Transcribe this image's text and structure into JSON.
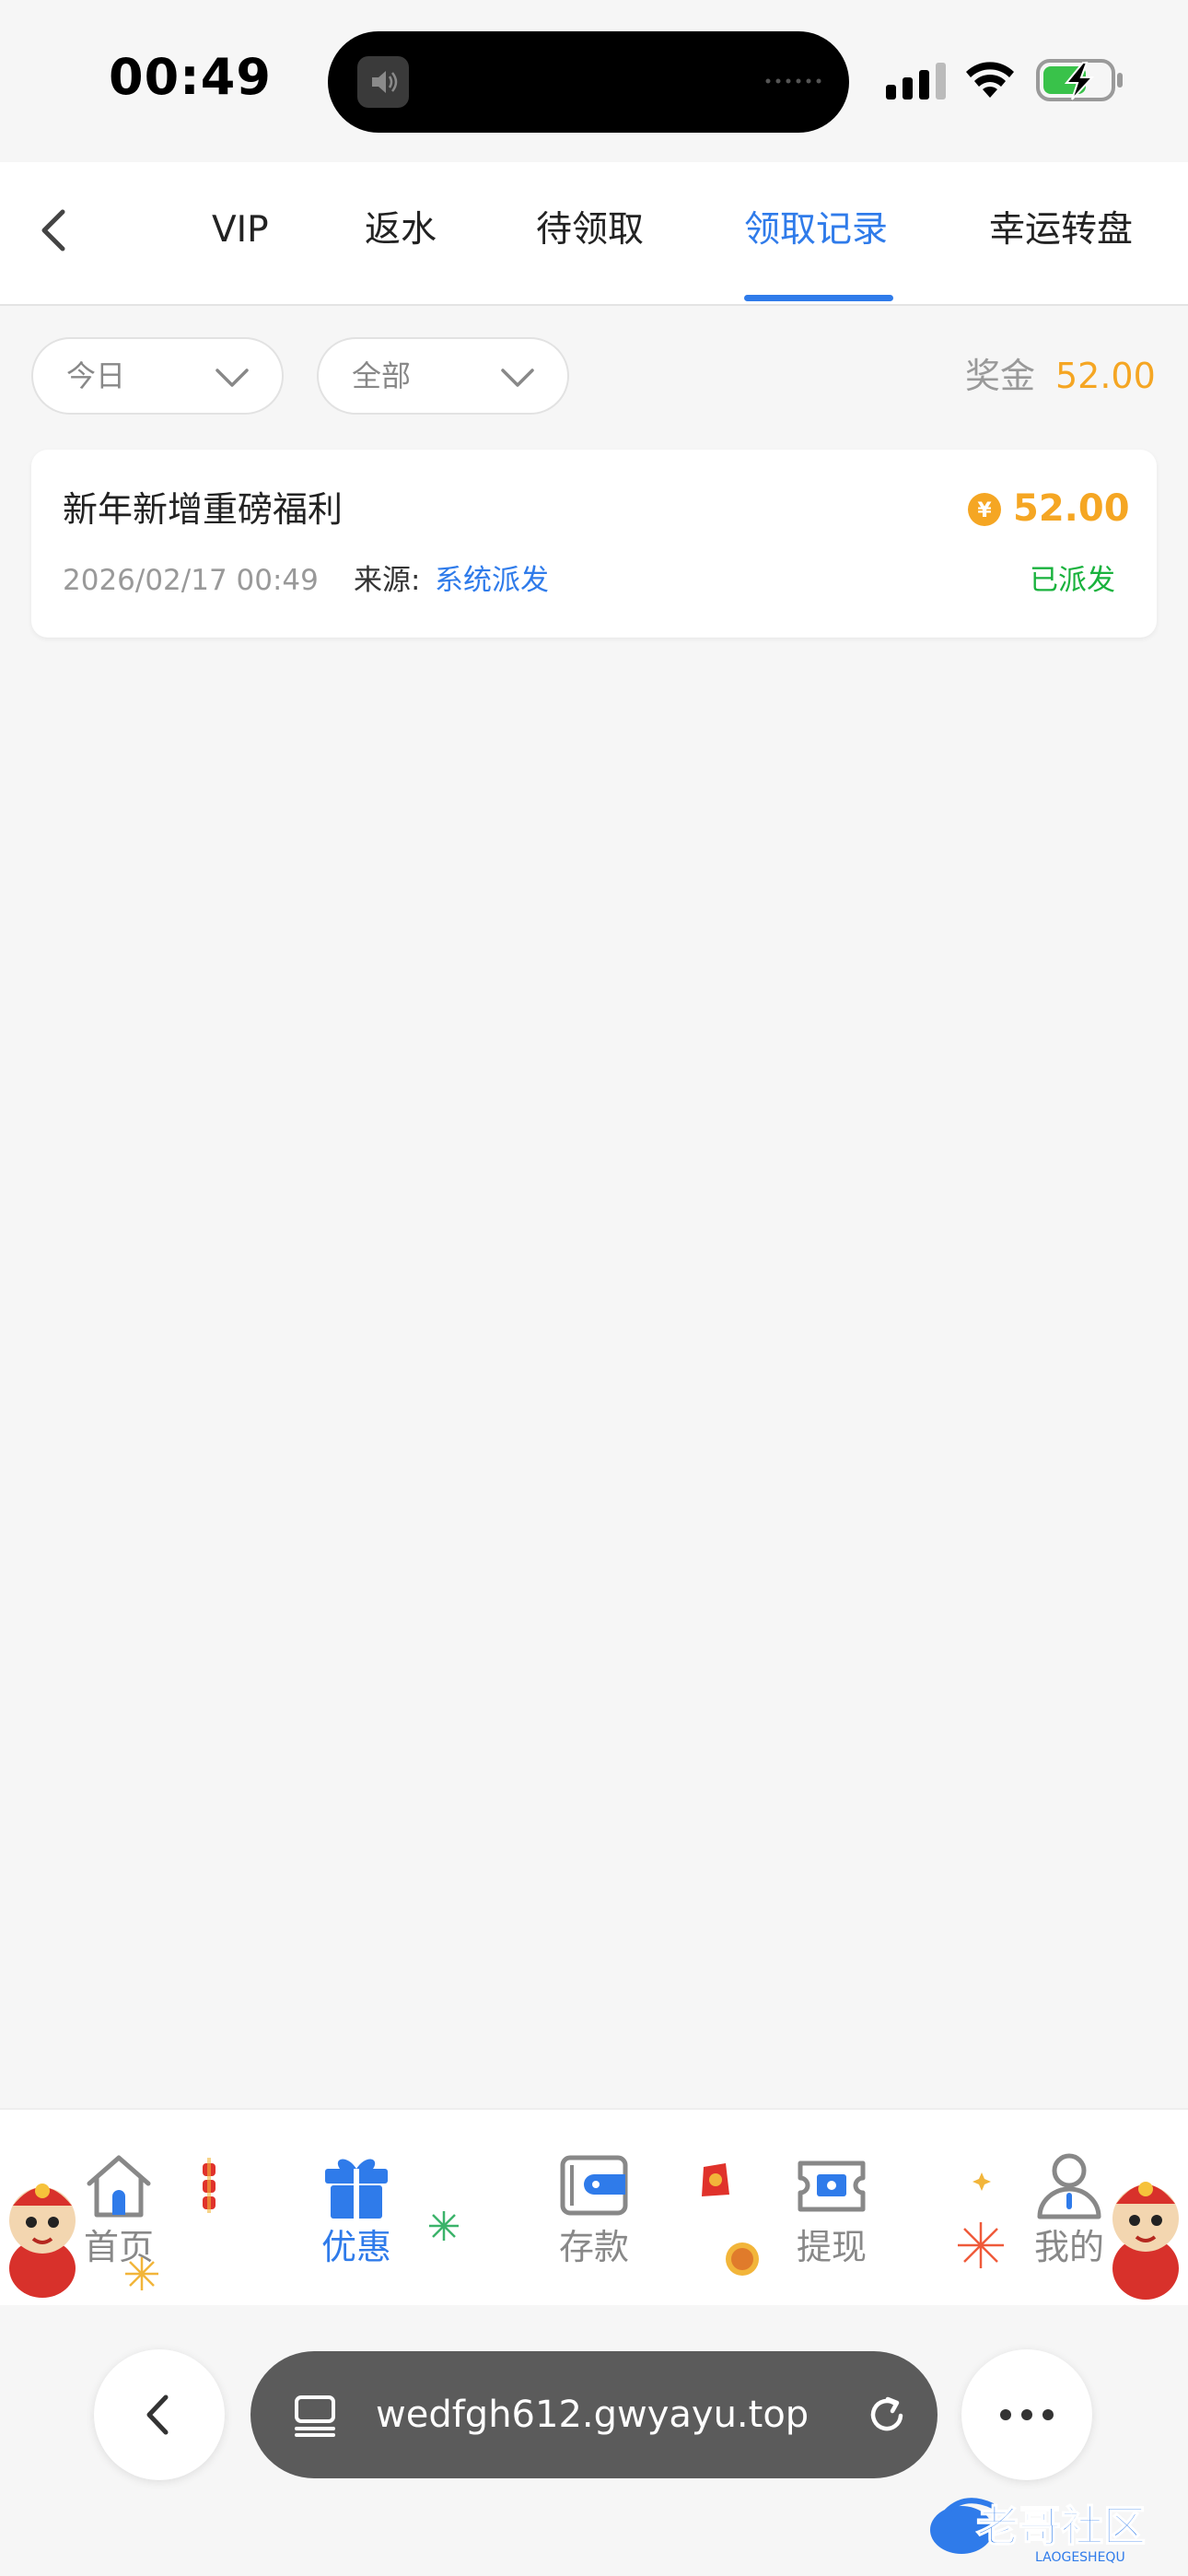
{
  "status_bar": {
    "time": "00:49"
  },
  "header": {
    "tabs": [
      {
        "label": "VIP",
        "active": false
      },
      {
        "label": "返水",
        "active": false
      },
      {
        "label": "待领取",
        "active": false
      },
      {
        "label": "领取记录",
        "active": true
      },
      {
        "label": "幸运转盘",
        "active": false
      }
    ]
  },
  "filters": {
    "date": {
      "value": "今日"
    },
    "type": {
      "value": "全部"
    },
    "bonus_label": "奖金",
    "bonus_value": "52.00"
  },
  "records": [
    {
      "title": "新年新增重磅福利",
      "amount": "52.00",
      "coin_symbol": "¥",
      "time": "2026/02/17 00:49",
      "source_label": "来源:",
      "source_value": "系统派发",
      "status": "已派发"
    }
  ],
  "bottom_nav": {
    "items": [
      {
        "label": "首页",
        "icon": "home-icon",
        "active": false
      },
      {
        "label": "优惠",
        "icon": "gift-icon",
        "active": true
      },
      {
        "label": "存款",
        "icon": "wallet-icon",
        "active": false
      },
      {
        "label": "提现",
        "icon": "withdraw-icon",
        "active": false
      },
      {
        "label": "我的",
        "icon": "user-icon",
        "active": false
      }
    ]
  },
  "browser": {
    "url": "wedfgh612.gwyayu.top"
  },
  "watermark": {
    "text": "老哥社区",
    "subtext": "LAOGESHEQU"
  },
  "colors": {
    "accent": "#2f7bea",
    "gold": "#f5a623",
    "success": "#19b23d",
    "background": "#f6f6f6"
  }
}
